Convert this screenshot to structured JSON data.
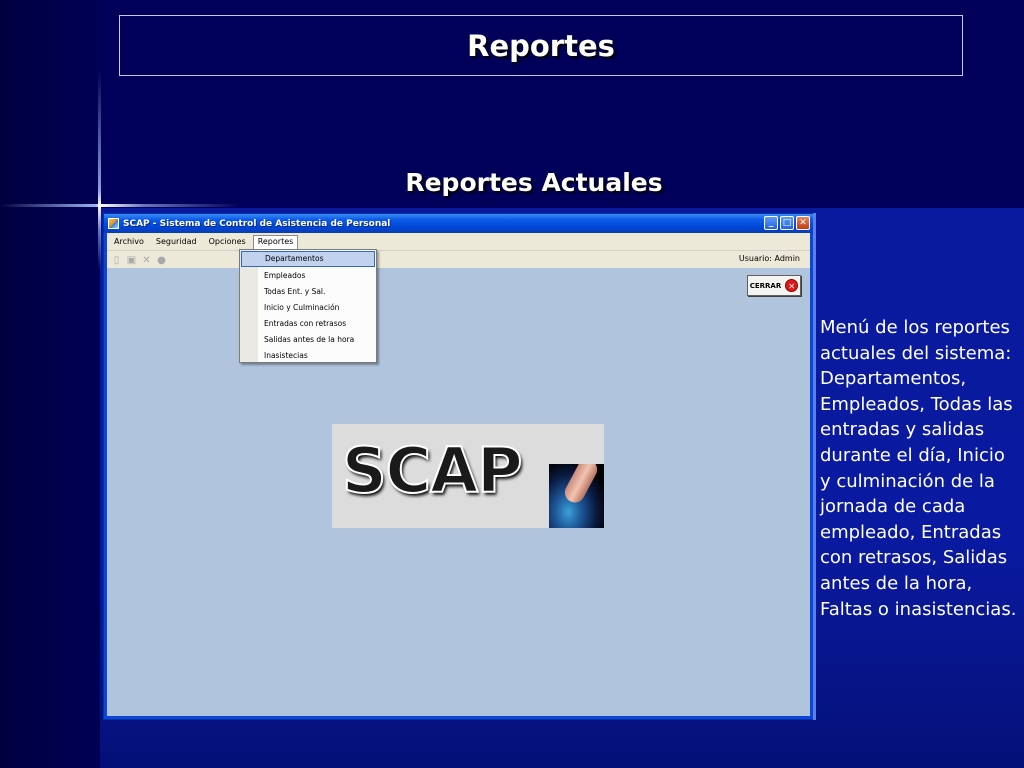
{
  "slide": {
    "title": "Reportes",
    "subtitle": "Reportes Actuales",
    "description": "Menú de los reportes actuales del sistema: Departamentos, Empleados, Todas las entradas y salidas durante el día, Inicio y culminación de la jornada de cada empleado, Entradas con retrasos, Salidas antes de la hora, Faltas o inasistencias."
  },
  "app": {
    "window_title": "SCAP - Sistema de Control de Asistencia de Personal",
    "menu": [
      "Archivo",
      "Seguridad",
      "Opciones",
      "Reportes"
    ],
    "open_menu": "Reportes",
    "user_label": "Usuario: Admin",
    "close_button": "CERRAR",
    "logo_text": "SCAP",
    "reportes_items": [
      "Departamentos",
      "Empleados",
      "Todas Ent. y Sal.",
      "Inicio y Culminación",
      "Entradas con retrasos",
      "Salidas antes de la hora",
      "Inasistecias"
    ],
    "highlighted_item": "Departamentos",
    "toolbar_icons": [
      "new-document-icon",
      "save-icon",
      "delete-icon",
      "accept-icon"
    ]
  }
}
